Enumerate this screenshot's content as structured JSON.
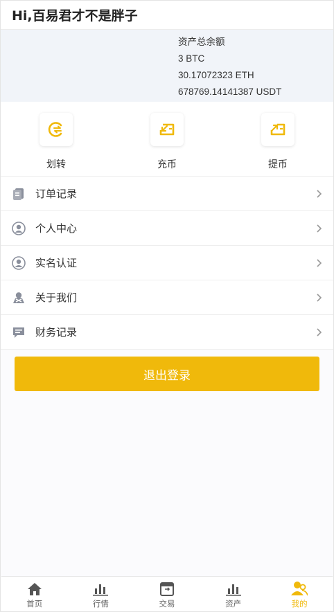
{
  "header": {
    "greeting": "Hi,百易君才不是胖子"
  },
  "balance": {
    "title": "资产总余额",
    "lines": [
      "3 BTC",
      "30.17072323 ETH",
      "678769.14141387 USDT"
    ]
  },
  "actions": [
    {
      "label": "划转",
      "icon": "transfer-icon"
    },
    {
      "label": "充币",
      "icon": "deposit-icon"
    },
    {
      "label": "提币",
      "icon": "withdraw-icon"
    }
  ],
  "menu": [
    {
      "label": "订单记录",
      "icon": "order-record-icon"
    },
    {
      "label": "个人中心",
      "icon": "user-icon"
    },
    {
      "label": "实名认证",
      "icon": "user-verify-icon"
    },
    {
      "label": "关于我们",
      "icon": "about-us-icon"
    },
    {
      "label": "财务记录",
      "icon": "finance-record-icon"
    }
  ],
  "logout_label": "退出登录",
  "tabs": [
    {
      "label": "首页",
      "icon": "home-icon",
      "active": false
    },
    {
      "label": "行情",
      "icon": "market-icon",
      "active": false
    },
    {
      "label": "交易",
      "icon": "trade-icon",
      "active": false
    },
    {
      "label": "资产",
      "icon": "assets-icon",
      "active": false
    },
    {
      "label": "我的",
      "icon": "profile-icon",
      "active": true
    }
  ],
  "colors": {
    "accent": "#f0b90b",
    "icon_gray": "#8a8f9c"
  }
}
